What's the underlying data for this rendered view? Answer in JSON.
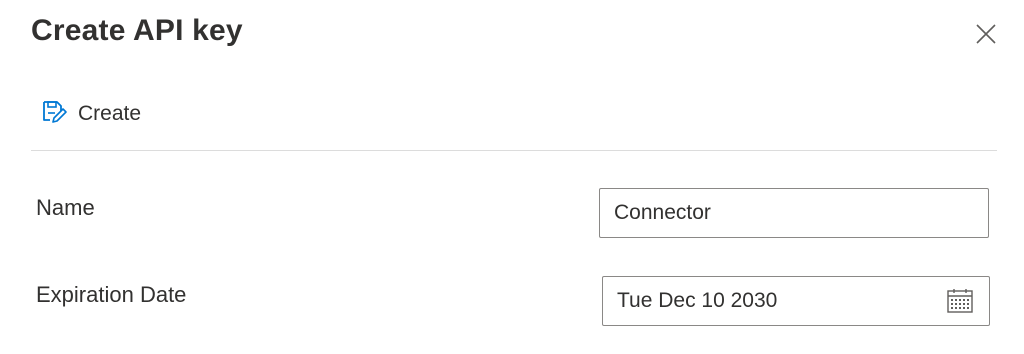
{
  "dialog": {
    "title": "Create API key",
    "close_icon": "close-icon"
  },
  "toolbar": {
    "create_label": "Create",
    "create_icon": "save-edit-icon"
  },
  "form": {
    "name_label": "Name",
    "name_value": "Connector",
    "expiration_label": "Expiration Date",
    "expiration_value": "Tue Dec 10 2030",
    "calendar_icon": "calendar-icon"
  },
  "colors": {
    "accent": "#0078d4",
    "text": "#323130",
    "border": "#8a8886",
    "divider": "#dcdcdc"
  }
}
